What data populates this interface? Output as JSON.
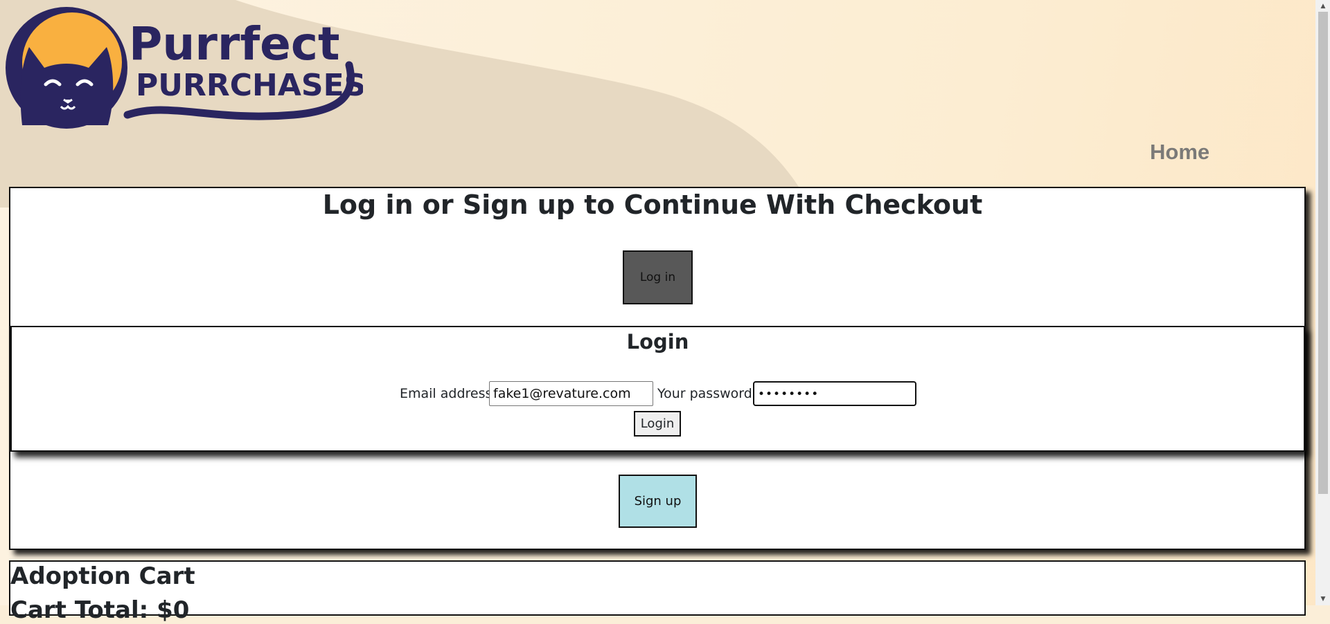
{
  "brand": {
    "name_line1": "Purrfect",
    "name_line2": "PURRCHASES"
  },
  "nav": {
    "home_label": "Home"
  },
  "checkout": {
    "title": "Log in or Sign up to Continue With Checkout",
    "login_toggle_label": "Log in",
    "signup_label": "Sign up"
  },
  "login_form": {
    "heading": "Login",
    "email_label": "Email address:",
    "email_value": "fake1@revature.com",
    "password_label": "Your password:",
    "password_value": "••••••••",
    "submit_label": "Login"
  },
  "cart": {
    "title": "Adoption Cart",
    "total": "Cart Total: $0"
  },
  "colors": {
    "brand_navy": "#2a2560",
    "brand_orange": "#f9b040",
    "login_toggle_bg": "#585858",
    "signup_bg": "#b0e0e6",
    "nav_text": "#7b7a78"
  }
}
